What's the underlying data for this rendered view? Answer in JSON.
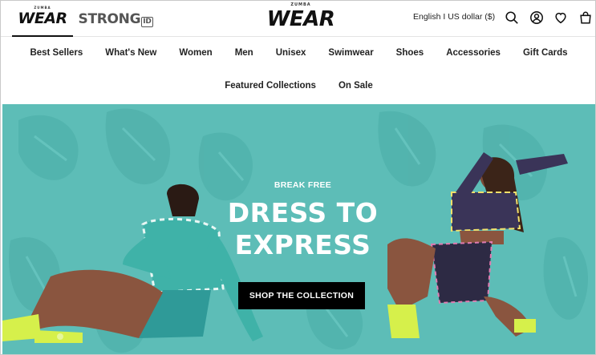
{
  "brands": {
    "wear_tab": {
      "label": "WEAR",
      "sup": "ZUMBA",
      "active": true
    },
    "strong_tab": {
      "label": "STRONG",
      "badge": "ID"
    }
  },
  "header": {
    "logo": {
      "text": "WEAR",
      "sup": "ZUMBA"
    },
    "locale_label": "English I US dollar ($)",
    "icons": [
      "search-icon",
      "account-icon",
      "wishlist-heart-icon",
      "cart-bag-icon"
    ]
  },
  "nav": {
    "row1": [
      "Best Sellers",
      "What's New",
      "Women",
      "Men",
      "Unisex",
      "Swimwear",
      "Shoes",
      "Accessories",
      "Gift Cards"
    ],
    "row2": [
      "Featured Collections",
      "On Sale"
    ]
  },
  "hero": {
    "eyebrow": "BREAK FREE",
    "title_line1": "DRESS TO",
    "title_line2": "EXPRESS",
    "cta_label": "SHOP THE COLLECTION",
    "background_color": "#5dbdb7"
  },
  "colors": {
    "accent": "#000000",
    "hero_bg": "#5dbdb7",
    "text": "#111111"
  }
}
